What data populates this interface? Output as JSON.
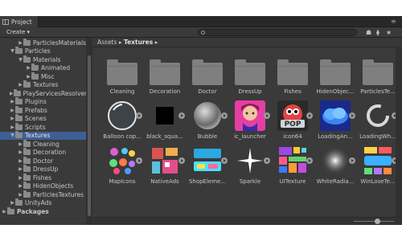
{
  "window": {
    "tab_title": "Project"
  },
  "toolbar": {
    "create_label": "Create ▾"
  },
  "tree": [
    {
      "label": "ParticlesMaterials",
      "level": 2,
      "expanded": false
    },
    {
      "label": "Particles",
      "level": 1,
      "expanded": true
    },
    {
      "label": "Materials",
      "level": 2,
      "expanded": true
    },
    {
      "label": "Animated",
      "level": 3,
      "expanded": false
    },
    {
      "label": "Misc",
      "level": 3,
      "expanded": false
    },
    {
      "label": "Textures",
      "level": 2,
      "expanded": false
    },
    {
      "label": "PlayServicesResolver",
      "level": 1,
      "expanded": false
    },
    {
      "label": "Plugins",
      "level": 1,
      "expanded": false
    },
    {
      "label": "Prefabs",
      "level": 1,
      "expanded": false
    },
    {
      "label": "Scenes",
      "level": 1,
      "expanded": false
    },
    {
      "label": "Scripts",
      "level": 1,
      "expanded": false
    },
    {
      "label": "Textures",
      "level": 1,
      "expanded": true,
      "selected": true
    },
    {
      "label": "Cleaning",
      "level": 2,
      "expanded": false
    },
    {
      "label": "Decoration",
      "level": 2,
      "expanded": false
    },
    {
      "label": "Doctor",
      "level": 2,
      "expanded": false
    },
    {
      "label": "DressUp",
      "level": 2,
      "expanded": false
    },
    {
      "label": "Fishes",
      "level": 2,
      "expanded": false
    },
    {
      "label": "HidenObjects",
      "level": 2,
      "expanded": false
    },
    {
      "label": "ParticlesTextures",
      "level": 2,
      "expanded": false
    },
    {
      "label": "UnityAds",
      "level": 1,
      "expanded": false
    },
    {
      "label": "Packages",
      "level": 0,
      "expanded": false
    }
  ],
  "breadcrumb": {
    "root": "Assets",
    "sep": "▸",
    "current": "Textures"
  },
  "assets": [
    {
      "label": "Cleaning",
      "kind": "folder"
    },
    {
      "label": "Decoration",
      "kind": "folder"
    },
    {
      "label": "Doctor",
      "kind": "folder"
    },
    {
      "label": "DressUp",
      "kind": "folder"
    },
    {
      "label": "Fishes",
      "kind": "folder"
    },
    {
      "label": "HidenObjec...",
      "kind": "folder"
    },
    {
      "label": "ParticlesTe...",
      "kind": "folder"
    },
    {
      "label": "Balloon cop...",
      "kind": "balloon"
    },
    {
      "label": "black_squa...",
      "kind": "black"
    },
    {
      "label": "Bubble",
      "kind": "bubble"
    },
    {
      "label": "ic_launcher",
      "kind": "girl"
    },
    {
      "label": "icon64",
      "kind": "pop"
    },
    {
      "label": "LoadingAn...",
      "kind": "cloud"
    },
    {
      "label": "LoadingWh...",
      "kind": "spinner"
    },
    {
      "label": "MapIcons",
      "kind": "mapicons"
    },
    {
      "label": "NativeAds",
      "kind": "nativeads"
    },
    {
      "label": "ShopEleme...",
      "kind": "shop"
    },
    {
      "label": "Sparkle",
      "kind": "sparkle"
    },
    {
      "label": "UITexture",
      "kind": "uitexture"
    },
    {
      "label": "WhiteRadia...",
      "kind": "radial"
    },
    {
      "label": "WinLoseTe...",
      "kind": "winlose"
    }
  ],
  "colors": {
    "selection": "#3e5f96",
    "panel": "#3a3a3a",
    "folder": "#7f7f7f"
  }
}
